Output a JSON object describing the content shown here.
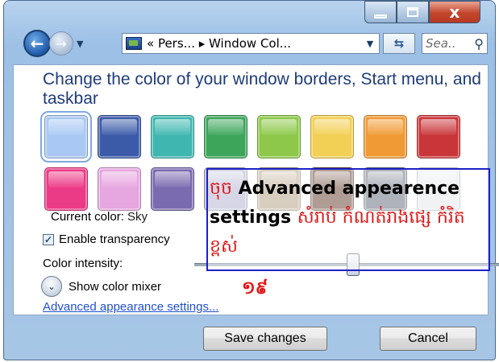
{
  "titlebar": {
    "minimize_icon": "minimize-icon",
    "maximize_icon": "maximize-icon",
    "close_label": "x"
  },
  "nav": {
    "back_icon": "back-arrow-icon",
    "forward_icon": "forward-arrow-icon",
    "address_text": "« Pers... ▸ Window Col...",
    "refresh_icon": "refresh-icon",
    "search_placeholder": "Sea..",
    "search_icon": "search-icon"
  },
  "panel": {
    "heading": "Change the color of your window borders, Start menu, and taskbar",
    "swatches": [
      {
        "name": "sky",
        "color": "#a9c8f3",
        "selected": true
      },
      {
        "name": "twilight",
        "color": "#3b5aa8"
      },
      {
        "name": "sea",
        "color": "#3fb7b0"
      },
      {
        "name": "leaf",
        "color": "#3da55a"
      },
      {
        "name": "lime",
        "color": "#8dc84a"
      },
      {
        "name": "lemon",
        "color": "#f2cf55"
      },
      {
        "name": "pumpkin",
        "color": "#f09a35"
      },
      {
        "name": "ruby",
        "color": "#c9363a"
      },
      {
        "name": "fuchsia",
        "color": "#ec3b86"
      },
      {
        "name": "blush",
        "color": "#e6a6df"
      },
      {
        "name": "violet",
        "color": "#7a6ab0"
      },
      {
        "name": "lavender",
        "color": "#b4b4d2"
      },
      {
        "name": "taupe",
        "color": "#b7a68c"
      },
      {
        "name": "chocolate",
        "color": "#6d4b3c"
      },
      {
        "name": "slate",
        "color": "#6c7482"
      },
      {
        "name": "frost",
        "color": "#e4e7ec"
      }
    ],
    "current_color_label": "Current color:",
    "current_color_value": "Sky",
    "transparency_label": "Enable transparency",
    "intensity_label": "Color intensity:",
    "intensity_value": 0.52,
    "mixer_label": "Show color mixer",
    "advanced_link": "Advanced appearance settings..."
  },
  "annotation": {
    "khmer_prefix": "ចុច",
    "english": "Advanced appearence settings",
    "khmer_suffix": "សំរាប់ កំណត់រាងផ្សេ កំរិតខ្ពស់",
    "number": "១៩"
  },
  "footer": {
    "save_label": "Save changes",
    "cancel_label": "Cancel"
  }
}
